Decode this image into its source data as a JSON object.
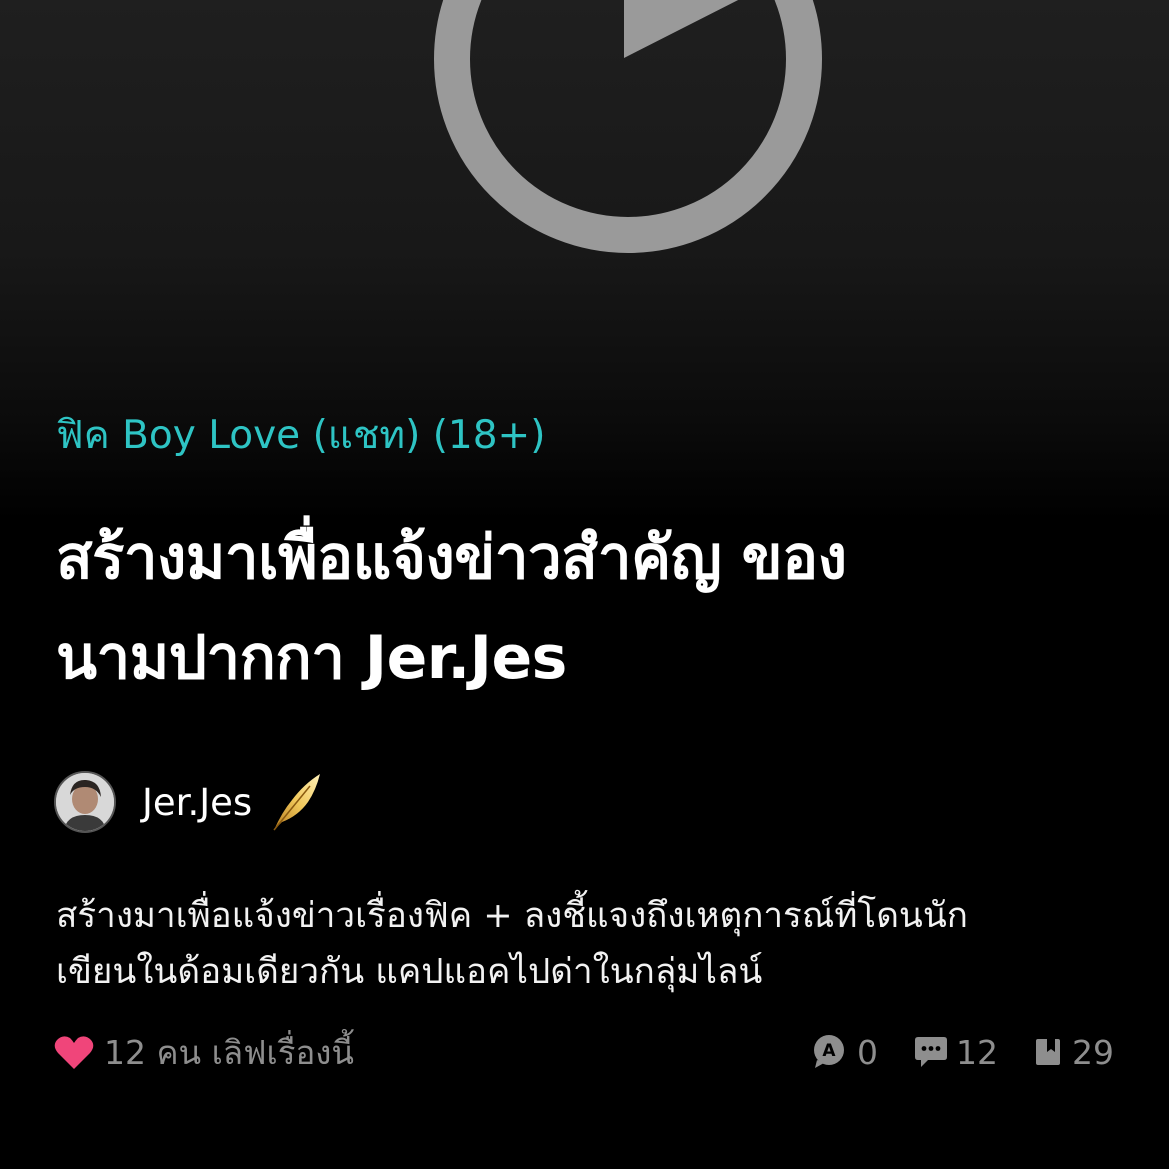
{
  "story": {
    "category": "ฟิค Boy Love (แชท) (18+)",
    "title_line1": "สร้างมาเพื่อแจ้งข่าวสำคัญ ของ",
    "title_line2": "นามปากกา Jer.Jes",
    "author": "Jer.Jes",
    "description_line1": "สร้างมาเพื่อแจ้งข่าวเรื่องฟิค + ลงชี้แจงถึงเหตุการณ์ที่โดนนัก",
    "description_line2": "เขียนในด้อมเดียวกัน แคปแอคไปด่าในกลุ่มไลน์"
  },
  "footer": {
    "likes": "12 คน เลิฟเรื่องนี้",
    "awards": "0",
    "comments": "12",
    "bookmarks": "29"
  },
  "colors": {
    "category": "#2ec4c4",
    "heart": "#f0457a",
    "muted": "#8e8e8e"
  },
  "icons": [
    "play-icon",
    "avatar",
    "feather-icon",
    "heart-icon",
    "award-icon",
    "comment-icon",
    "bookmark-icon"
  ]
}
